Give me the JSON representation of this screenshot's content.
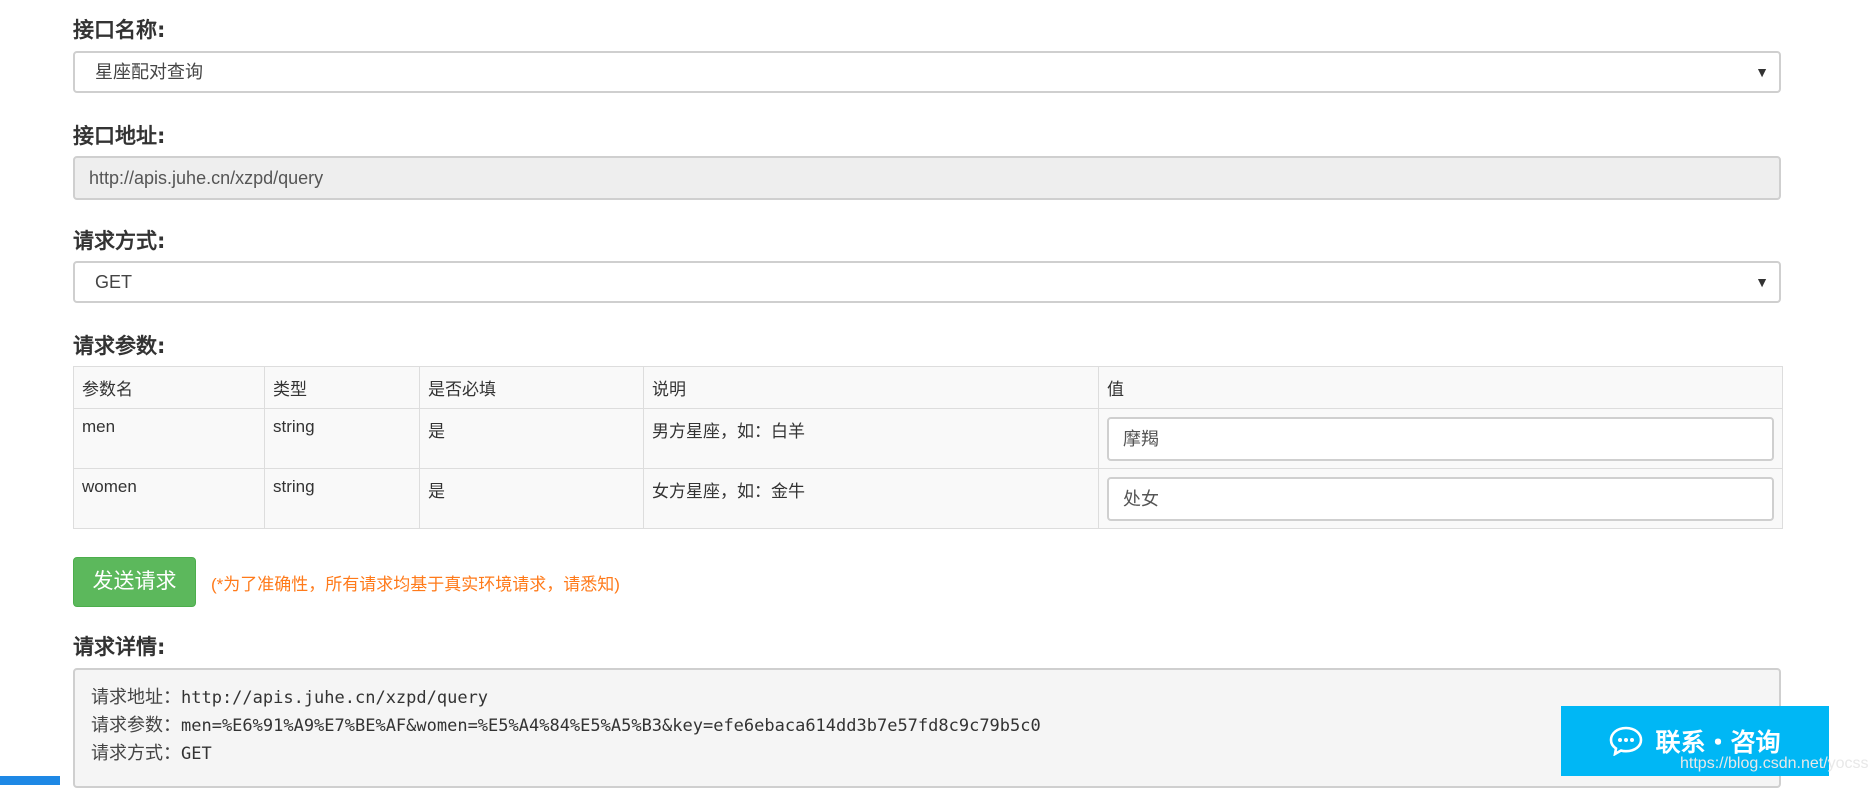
{
  "form": {
    "api_name_label": "接口名称:",
    "api_name_value": "星座配对查询",
    "api_address_label": "接口地址:",
    "api_address_value": "http://apis.juhe.cn/xzpd/query",
    "method_label": "请求方式:",
    "method_value": "GET",
    "params_label": "请求参数:"
  },
  "params_table": {
    "headers": [
      "参数名",
      "类型",
      "是否必填",
      "说明",
      "值"
    ],
    "rows": [
      {
        "name": "men",
        "type": "string",
        "required": "是",
        "desc": "男方星座，如：白羊",
        "value": "摩羯"
      },
      {
        "name": "women",
        "type": "string",
        "required": "是",
        "desc": "女方星座，如：金牛",
        "value": "处女"
      }
    ]
  },
  "actions": {
    "send_label": "发送请求",
    "note": "(*为了准确性，所有请求均基于真实环境请求，请悉知)"
  },
  "details": {
    "label": "请求详情:",
    "address_key": "请求地址：",
    "address_value": "http://apis.juhe.cn/xzpd/query",
    "params_key": "请求参数：",
    "params_value": "men=%E6%91%A9%E7%BE%AF&women=%E5%A4%84%E5%A5%B3&key=efe6ebaca614dd3b7e57fd8c9c79b5c0",
    "method_key": "请求方式：",
    "method_value": "GET"
  },
  "widget": {
    "label": "联系・咨询",
    "icon": "chat-bubble-icon"
  },
  "watermark": "https://blog.csdn.net/yocss",
  "colors": {
    "send_button": "#5cb85c",
    "note": "#ff7a1a",
    "chat_widget": "#00b7f5"
  }
}
